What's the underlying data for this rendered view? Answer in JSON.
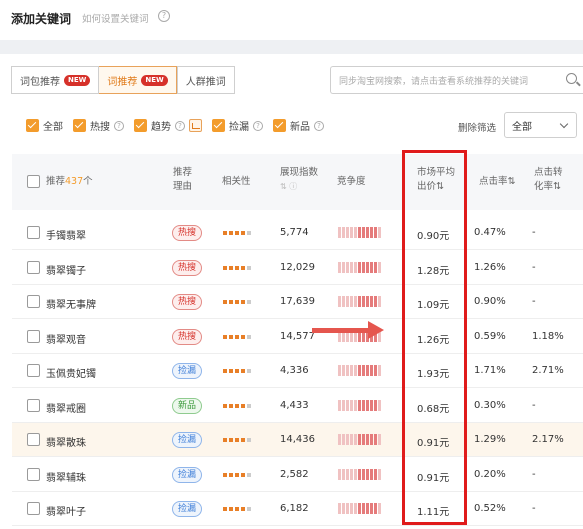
{
  "header": {
    "title": "添加关键词",
    "help": "如何设置关键词",
    "help_icon": "question-icon"
  },
  "tabs": [
    {
      "label": "词包推荐",
      "badge": "NEW",
      "active": false
    },
    {
      "label": "词推荐",
      "badge": "NEW",
      "active": true
    },
    {
      "label": "人群推词",
      "badge": "",
      "active": false
    }
  ],
  "search": {
    "placeholder": "同步淘宝网搜索，请点击查看系统推荐的关键词"
  },
  "filters": {
    "items": [
      {
        "label": "全部",
        "checked": true,
        "help": false
      },
      {
        "label": "热搜",
        "checked": true,
        "help": true
      },
      {
        "label": "趋势",
        "checked": true,
        "help": true
      },
      {
        "label": "捡漏",
        "checked": true,
        "help": true
      },
      {
        "label": "新品",
        "checked": true,
        "help": true
      }
    ],
    "side_label": "删除筛选",
    "select_value": "全部"
  },
  "table": {
    "headers": {
      "keyword_prefix": "推荐",
      "keyword_count": "437",
      "keyword_suffix": "个",
      "reason_1": "推荐",
      "reason_2": "理由",
      "relevance": "相关性",
      "impressions_1": "展现指数",
      "impressions_2": "⇅ ⓘ",
      "competition": "竞争度",
      "price_1": "市场平均",
      "price_2": "出价⇅",
      "ctr": "点击率⇅",
      "cvr_1": "点击转",
      "cvr_2": "化率⇅"
    },
    "rows": [
      {
        "keyword": "手镯翡翠",
        "reason": "热搜",
        "reason_type": "hot",
        "rel": 4,
        "impressions": "5,774",
        "comp": 5,
        "price": "0.90元",
        "ctr": "0.47%",
        "cvr": "-",
        "highlight": false
      },
      {
        "keyword": "翡翠镯子",
        "reason": "热搜",
        "reason_type": "hot",
        "rel": 4,
        "impressions": "12,029",
        "comp": 5,
        "price": "1.28元",
        "ctr": "1.26%",
        "cvr": "-",
        "highlight": false
      },
      {
        "keyword": "翡翠无事牌",
        "reason": "热搜",
        "reason_type": "hot",
        "rel": 4,
        "impressions": "17,639",
        "comp": 5,
        "price": "1.09元",
        "ctr": "0.90%",
        "cvr": "-",
        "highlight": false
      },
      {
        "keyword": "翡翠观音",
        "reason": "热搜",
        "reason_type": "hot",
        "rel": 4,
        "impressions": "14,577",
        "comp": 5,
        "price": "1.26元",
        "ctr": "0.59%",
        "cvr": "1.18%",
        "highlight": false
      },
      {
        "keyword": "玉佩贵妃镯",
        "reason": "捡漏",
        "reason_type": "miss",
        "rel": 4,
        "impressions": "4,336",
        "comp": 5,
        "price": "1.93元",
        "ctr": "1.71%",
        "cvr": "2.71%",
        "highlight": false
      },
      {
        "keyword": "翡翠戒圈",
        "reason": "新品",
        "reason_type": "new",
        "rel": 4,
        "impressions": "4,433",
        "comp": 5,
        "price": "0.68元",
        "ctr": "0.30%",
        "cvr": "-",
        "highlight": false
      },
      {
        "keyword": "翡翠散珠",
        "reason": "捡漏",
        "reason_type": "miss",
        "rel": 4,
        "impressions": "14,436",
        "comp": 5,
        "price": "0.91元",
        "ctr": "1.29%",
        "cvr": "2.17%",
        "highlight": true
      },
      {
        "keyword": "翡翠辅珠",
        "reason": "捡漏",
        "reason_type": "miss",
        "rel": 4,
        "impressions": "2,582",
        "comp": 5,
        "price": "0.91元",
        "ctr": "0.20%",
        "cvr": "-",
        "highlight": false
      },
      {
        "keyword": "翡翠叶子",
        "reason": "捡漏",
        "reason_type": "miss",
        "rel": 4,
        "impressions": "6,182",
        "comp": 5,
        "price": "1.11元",
        "ctr": "0.52%",
        "cvr": "-",
        "highlight": false
      }
    ]
  },
  "colors": {
    "accent": "#f39c2c",
    "highlight_box": "#e01b1b",
    "arrow": "#e5564e"
  }
}
